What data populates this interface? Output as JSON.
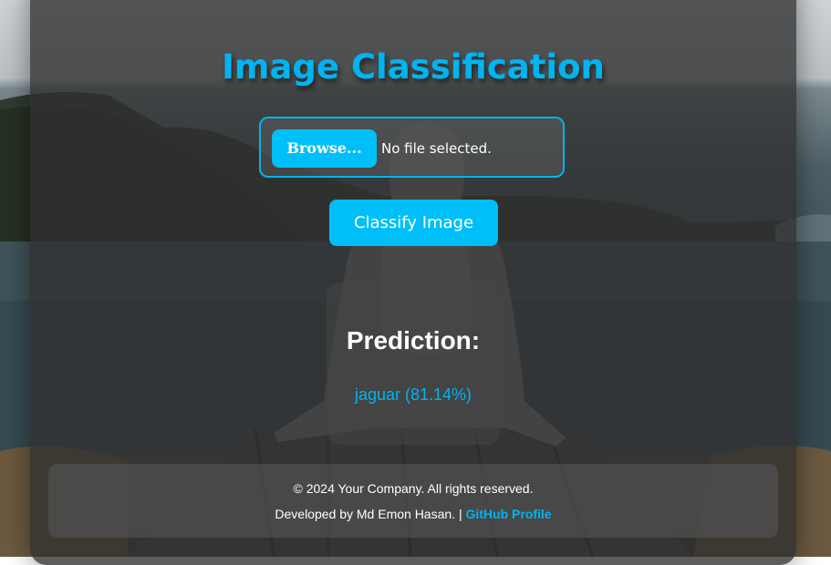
{
  "app": {
    "title": "Image Classification"
  },
  "upload": {
    "browse_label": "Browse...",
    "file_status": "No file selected."
  },
  "actions": {
    "classify_label": "Classify Image"
  },
  "prediction": {
    "heading": "Prediction:",
    "result": "jaguar (81.14%)"
  },
  "footer": {
    "copyright": "© 2024 Your Company. All rights reserved.",
    "developer_text": "Developed by Md Emon Hasan.",
    "separator": "|",
    "github_label": "GitHub Profile"
  },
  "colors": {
    "accent": "#00b4f0",
    "button": "#00bff8",
    "card": "#303030"
  }
}
